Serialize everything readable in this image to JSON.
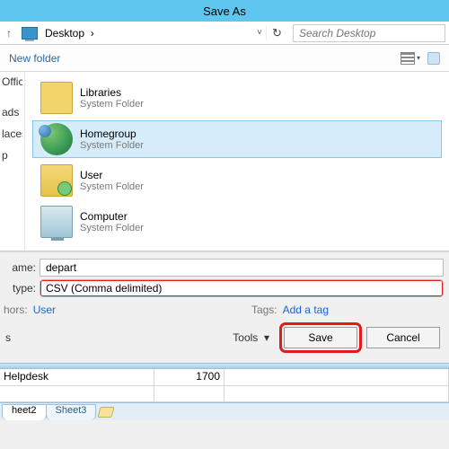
{
  "title": "Save As",
  "addr": {
    "location": "Desktop",
    "search_placeholder": "Search Desktop"
  },
  "toolbar": {
    "new_folder": "New folder"
  },
  "sidebar": {
    "items": [
      "Office E",
      "",
      "ads",
      "laces",
      "p"
    ]
  },
  "items": [
    {
      "name": "Libraries",
      "sub": "System Folder"
    },
    {
      "name": "Homegroup",
      "sub": "System Folder"
    },
    {
      "name": "User",
      "sub": "System Folder"
    },
    {
      "name": "Computer",
      "sub": "System Folder"
    }
  ],
  "fields": {
    "name_label": "ame:",
    "name_value": "depart",
    "type_label": "type:",
    "type_value": "CSV (Comma delimited)",
    "authors_label": "hors:",
    "authors_value": "User",
    "tags_label": "Tags:",
    "tags_value": "Add a tag"
  },
  "actions": {
    "tools": "Tools",
    "save": "Save",
    "cancel": "Cancel"
  },
  "sheet": {
    "row": {
      "a": "Helpdesk",
      "b": "1700"
    },
    "tabs": [
      "heet2",
      "Sheet3"
    ]
  }
}
